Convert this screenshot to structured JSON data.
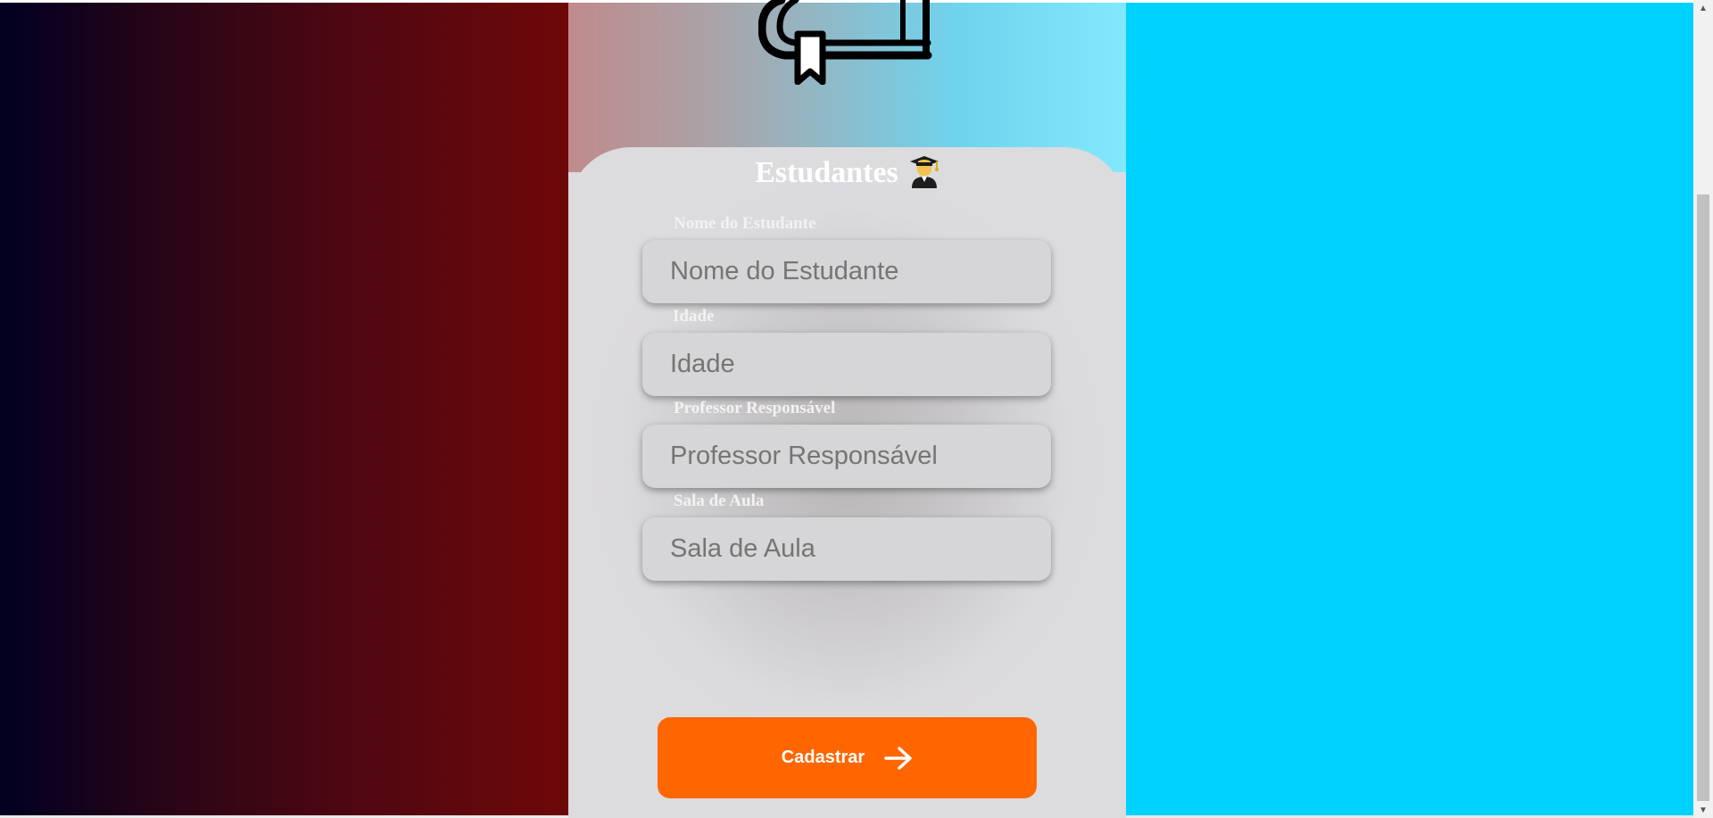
{
  "form": {
    "title": "Estudantes",
    "title_icon": "graduate-student-icon",
    "fields": [
      {
        "label": "Nome do Estudante",
        "placeholder": "Nome do Estudante",
        "value": ""
      },
      {
        "label": "Idade",
        "placeholder": "Idade",
        "value": ""
      },
      {
        "label": "Professor Responsável",
        "placeholder": "Professor Responsável",
        "value": ""
      },
      {
        "label": "Sala de Aula",
        "placeholder": "Sala de Aula",
        "value": ""
      }
    ],
    "submit_label": "Cadastrar",
    "submit_icon": "arrow-right-icon"
  },
  "logo": {
    "icon": "book-icon"
  },
  "colors": {
    "submit": "#ff6600",
    "right_panel": "#00d2ff",
    "left_gradient_start": "#000022",
    "left_gradient_end": "#6e0808",
    "card": "#dcdbde",
    "label_text": "#f2f2f2"
  },
  "scrollbar": {
    "up_icon": "scroll-up-arrow-icon",
    "down_icon": "scroll-down-arrow-icon"
  }
}
